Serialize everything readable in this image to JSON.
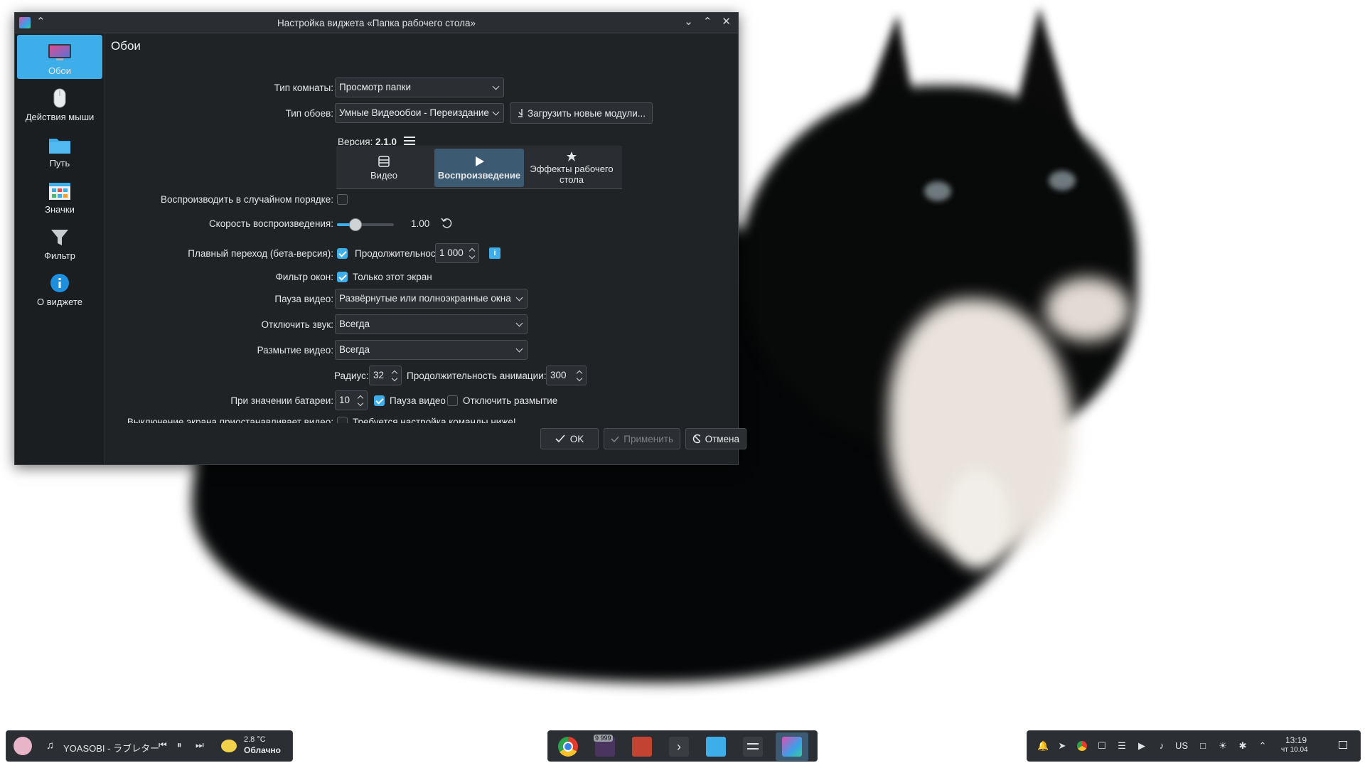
{
  "dialog": {
    "title": "Настройка виджета «Папка рабочего стола»",
    "page_title": "Обои"
  },
  "sidebar": {
    "items": [
      {
        "label": "Обои",
        "icon": "wallpaper-icon",
        "active": true
      },
      {
        "label": "Действия мыши",
        "icon": "mouse-icon",
        "active": false
      },
      {
        "label": "Путь",
        "icon": "folder-icon",
        "active": false
      },
      {
        "label": "Значки",
        "icon": "icons-icon",
        "active": false
      },
      {
        "label": "Фильтр",
        "icon": "filter-icon",
        "active": false
      },
      {
        "label": "О виджете",
        "icon": "info-icon",
        "active": false
      }
    ]
  },
  "form": {
    "layout_label": "Тип комнаты:",
    "layout_value": "Просмотр папки",
    "wallpaper_label": "Тип обоев:",
    "wallpaper_value": "Умные Видеообои - Переиздание",
    "download_button": "Загрузить новые модули...",
    "version_label": "Версия:",
    "version_value": "2.1.0",
    "tabs": [
      {
        "label": "Видео",
        "icon": "film-icon"
      },
      {
        "label": "Воспроизведение",
        "icon": "play-icon"
      },
      {
        "label": "Эффекты рабочего стола",
        "icon": "star-icon"
      }
    ],
    "shuffle_label": "Воспроизводить в случайном порядке:",
    "speed_label": "Скорость воспроизведения:",
    "speed_value": "1.00",
    "speed_fraction": 0.33,
    "crossfade_label": "Плавный переход (бета-версия):",
    "duration_label": "Продолжительность:",
    "duration_value": "1 000",
    "window_filter_label": "Фильтр окон:",
    "window_filter_check": "Только этот экран",
    "pause_label": "Пауза видео:",
    "pause_value": "Развёрнутые или полноэкранные окна",
    "mute_label": "Отключить звук:",
    "mute_value": "Всегда",
    "blur_label": "Размытие видео:",
    "blur_value": "Всегда",
    "radius_label": "Радиус:",
    "radius_value": "32",
    "anim_label": "Продолжительность анимации:",
    "anim_value": "300",
    "battery_label": "При значении батареи:",
    "battery_value": "10",
    "battery_pause": "Пауза видео",
    "battery_noblur": "Отключить размытие",
    "screen_off_label": "Выключение экрана приостанавливает видео:",
    "screen_off_note": "Требуется настройка команды ниже!"
  },
  "buttons": {
    "ok": "OK",
    "apply": "Применить",
    "cancel": "Отмена"
  },
  "taskbar": {
    "media_title": "YOASOBI - ラブレター",
    "weather_temp": "2.8 °C",
    "weather_desc": "Облачно",
    "badge_count": "9 999",
    "keyboard_layout": "US",
    "clock_time": "13:19",
    "clock_date": "чт 10.04"
  },
  "colors": {
    "accent": "#3daee9",
    "dialog_bg": "#202326",
    "sidebar_bg": "#1b1e20"
  }
}
